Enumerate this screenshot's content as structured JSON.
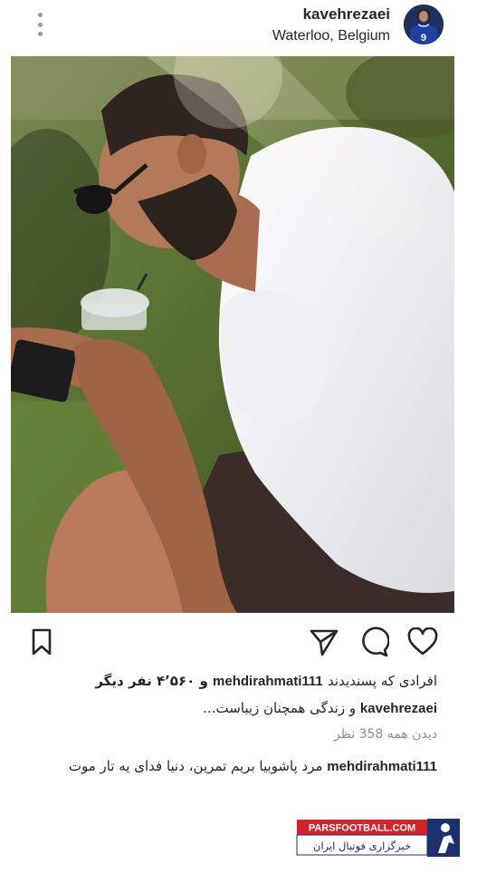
{
  "post": {
    "username": "kavehrezaei",
    "location": "Waterloo, Belgium"
  },
  "avatar": {
    "shirt_number": "9"
  },
  "likes": {
    "prefix": "افرادی که پسندیدند",
    "user": "mehdirahmati111",
    "suffix": "و ۴٬۵۶۰ نفر دیگر"
  },
  "caption": {
    "user": "kavehrezaei",
    "text": "و زندگی همچنان زیباست..."
  },
  "views": {
    "text": "دیدن همه 358 نظر"
  },
  "comment": {
    "user": "mehdirahmati111",
    "text": "مرد پاشوبیا بریم تمرین، دنیا فدای یه تار موت"
  },
  "watermark": {
    "brand": "PARSFOOTBALL.COM",
    "tagline": "خبرگزاری فوتبال ایران"
  },
  "icons": [
    "more-icon",
    "bookmark-icon",
    "share-icon",
    "comment-icon",
    "heart-icon"
  ],
  "colors": {
    "text": "#262626",
    "muted": "#8e8e8e",
    "watermark_red": "#d2232a",
    "watermark_navy": "#1c2f6e"
  }
}
